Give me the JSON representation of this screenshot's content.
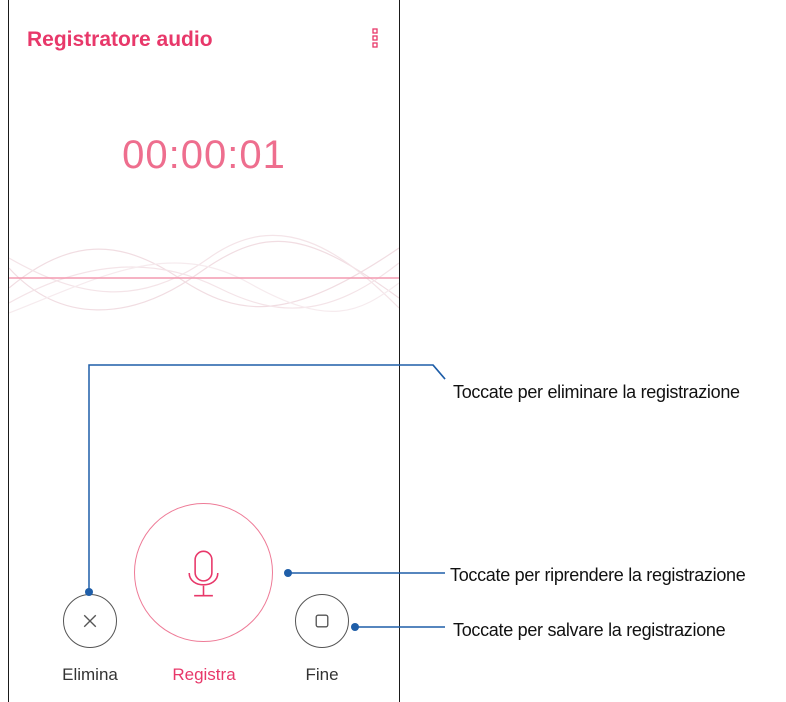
{
  "app": {
    "title": "Registratore audio",
    "menu_icon": "more-vert-icon"
  },
  "recorder": {
    "timer": "00:00:01",
    "accent_color": "#e8386a",
    "timer_color": "#ee6e8e"
  },
  "controls": {
    "delete": {
      "label": "Elimina",
      "icon": "close-icon"
    },
    "record": {
      "label": "Registra",
      "icon": "microphone-icon"
    },
    "stop": {
      "label": "Fine",
      "icon": "stop-icon"
    }
  },
  "callouts": {
    "delete": "Toccate per eliminare la registrazione",
    "record": "Toccate per riprendere la registrazione",
    "stop": "Toccate per salvare la registrazione",
    "line_color": "#1f5ea8"
  }
}
